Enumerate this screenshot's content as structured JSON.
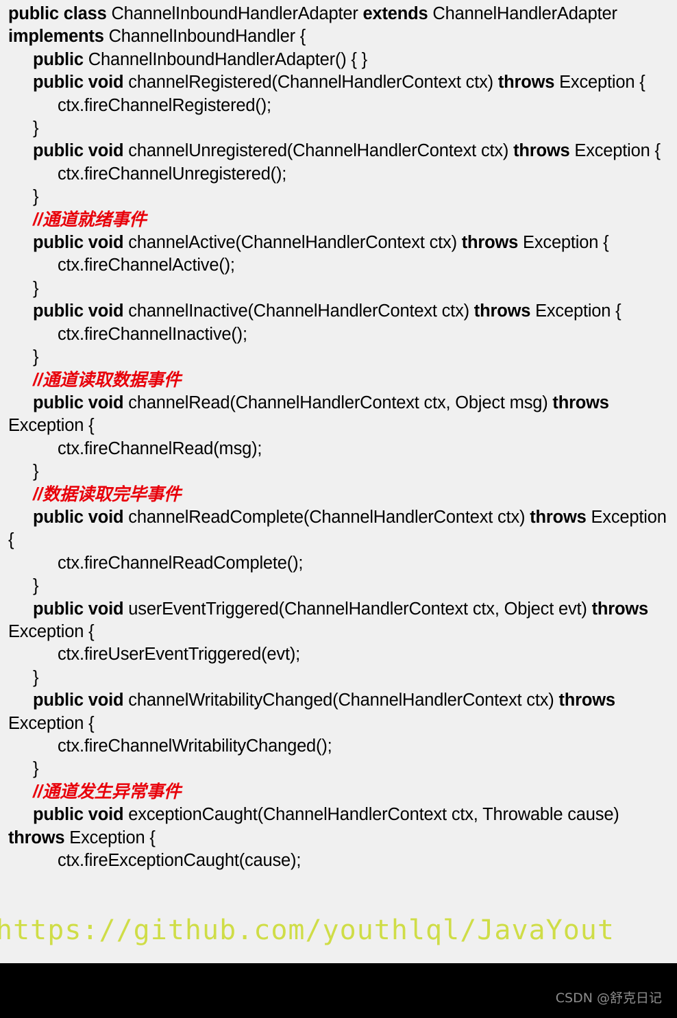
{
  "document": {
    "type": "java-code-snippet",
    "background_color": "#f0f0f0",
    "text_color": "#000000",
    "comment_color": "#e8000a",
    "bottom_bar_color": "#000000"
  },
  "code": {
    "lines": [
      {
        "id": "line-1",
        "indent": 0,
        "segments": [
          {
            "t": "public class ",
            "b": true
          },
          {
            "t": "ChannelInboundHandlerAdapter ",
            "b": false
          },
          {
            "t": "extends ",
            "b": true
          },
          {
            "t": "ChannelHandlerAdapter ",
            "b": false
          },
          {
            "t": "implements ",
            "b": true
          },
          {
            "t": "ChannelInboundHandler {",
            "b": false
          }
        ]
      },
      {
        "id": "line-2",
        "indent": 1,
        "segments": [
          {
            "t": "public ",
            "b": true
          },
          {
            "t": "ChannelInboundHandlerAdapter() { }",
            "b": false
          }
        ]
      },
      {
        "id": "line-3",
        "indent": 1,
        "segments": [
          {
            "t": "public void ",
            "b": true
          },
          {
            "t": "channelRegistered(ChannelHandlerContext ctx) ",
            "b": false
          },
          {
            "t": "throws ",
            "b": true
          },
          {
            "t": "Exception {",
            "b": false
          }
        ]
      },
      {
        "id": "line-4",
        "indent": 2,
        "segments": [
          {
            "t": "ctx.fireChannelRegistered();",
            "b": false
          }
        ]
      },
      {
        "id": "line-5",
        "indent": 1,
        "segments": [
          {
            "t": "}",
            "b": false
          }
        ]
      },
      {
        "id": "line-6",
        "indent": 1,
        "segments": [
          {
            "t": "public void ",
            "b": true
          },
          {
            "t": "channelUnregistered(ChannelHandlerContext ctx) ",
            "b": false
          },
          {
            "t": "throws ",
            "b": true
          },
          {
            "t": "Exception {",
            "b": false
          }
        ]
      },
      {
        "id": "line-7",
        "indent": 2,
        "segments": [
          {
            "t": "ctx.fireChannelUnregistered();",
            "b": false
          }
        ]
      },
      {
        "id": "line-8",
        "indent": 1,
        "segments": [
          {
            "t": "}",
            "b": false
          }
        ]
      },
      {
        "id": "line-9",
        "indent": 1,
        "comment": true,
        "segments": [
          {
            "t": "//通道就绪事件",
            "b": false
          }
        ]
      },
      {
        "id": "line-10",
        "indent": 1,
        "segments": [
          {
            "t": "public void ",
            "b": true
          },
          {
            "t": "channelActive(ChannelHandlerContext ctx) ",
            "b": false
          },
          {
            "t": "throws ",
            "b": true
          },
          {
            "t": "Exception {",
            "b": false
          }
        ]
      },
      {
        "id": "line-11",
        "indent": 2,
        "segments": [
          {
            "t": "ctx.fireChannelActive();",
            "b": false
          }
        ]
      },
      {
        "id": "line-12",
        "indent": 1,
        "segments": [
          {
            "t": "}",
            "b": false
          }
        ]
      },
      {
        "id": "line-13",
        "indent": 1,
        "segments": [
          {
            "t": "public void ",
            "b": true
          },
          {
            "t": "channelInactive(ChannelHandlerContext ctx) ",
            "b": false
          },
          {
            "t": "throws ",
            "b": true
          },
          {
            "t": "Exception {",
            "b": false
          }
        ]
      },
      {
        "id": "line-14",
        "indent": 2,
        "segments": [
          {
            "t": "ctx.fireChannelInactive();",
            "b": false
          }
        ]
      },
      {
        "id": "line-15",
        "indent": 1,
        "segments": [
          {
            "t": "}",
            "b": false
          }
        ]
      },
      {
        "id": "line-16",
        "indent": 1,
        "comment": true,
        "segments": [
          {
            "t": "//通道读取数据事件",
            "b": false
          }
        ]
      },
      {
        "id": "line-17",
        "indent": 1,
        "segments": [
          {
            "t": "public void ",
            "b": true
          },
          {
            "t": "channelRead(ChannelHandlerContext ctx, Object msg) ",
            "b": false
          },
          {
            "t": "throws ",
            "b": true
          },
          {
            "t": "Exception {",
            "b": false
          }
        ]
      },
      {
        "id": "line-18",
        "indent": 2,
        "segments": [
          {
            "t": "ctx.fireChannelRead(msg);",
            "b": false
          }
        ]
      },
      {
        "id": "line-19",
        "indent": 1,
        "segments": [
          {
            "t": "}",
            "b": false
          }
        ]
      },
      {
        "id": "line-20",
        "indent": 1,
        "comment": true,
        "segments": [
          {
            "t": "//数据读取完毕事件",
            "b": false
          }
        ]
      },
      {
        "id": "line-21",
        "indent": 1,
        "segments": [
          {
            "t": "public void ",
            "b": true
          },
          {
            "t": "channelReadComplete(ChannelHandlerContext ctx) ",
            "b": false
          },
          {
            "t": "throws ",
            "b": true
          },
          {
            "t": "Exception {",
            "b": false
          }
        ]
      },
      {
        "id": "line-22",
        "indent": 2,
        "segments": [
          {
            "t": "ctx.fireChannelReadComplete();",
            "b": false
          }
        ]
      },
      {
        "id": "line-23",
        "indent": 1,
        "segments": [
          {
            "t": "}",
            "b": false
          }
        ]
      },
      {
        "id": "line-24",
        "indent": 1,
        "segments": [
          {
            "t": "public void ",
            "b": true
          },
          {
            "t": "userEventTriggered(ChannelHandlerContext ctx, Object evt) ",
            "b": false
          },
          {
            "t": "throws ",
            "b": true
          },
          {
            "t": "Exception {",
            "b": false
          }
        ]
      },
      {
        "id": "line-25",
        "indent": 2,
        "segments": [
          {
            "t": "ctx.fireUserEventTriggered(evt);",
            "b": false
          }
        ]
      },
      {
        "id": "line-26",
        "indent": 1,
        "segments": [
          {
            "t": "}",
            "b": false
          }
        ]
      },
      {
        "id": "line-27",
        "indent": 1,
        "segments": [
          {
            "t": "public void ",
            "b": true
          },
          {
            "t": "channelWritabilityChanged(ChannelHandlerContext ctx) ",
            "b": false
          },
          {
            "t": "throws ",
            "b": true
          },
          {
            "t": "Exception {",
            "b": false
          }
        ]
      },
      {
        "id": "line-28",
        "indent": 2,
        "segments": [
          {
            "t": "ctx.fireChannelWritabilityChanged();",
            "b": false
          }
        ]
      },
      {
        "id": "line-29",
        "indent": 1,
        "segments": [
          {
            "t": "}",
            "b": false
          }
        ]
      },
      {
        "id": "line-30",
        "indent": 1,
        "comment": true,
        "segments": [
          {
            "t": "//通道发生异常事件",
            "b": false
          }
        ]
      },
      {
        "id": "line-31",
        "indent": 1,
        "segments": [
          {
            "t": "public void ",
            "b": true
          },
          {
            "t": "exceptionCaught(ChannelHandlerContext ctx, Throwable cause) ",
            "b": false
          },
          {
            "t": "throws ",
            "b": true
          },
          {
            "t": "Exception {",
            "b": false
          }
        ]
      },
      {
        "id": "line-32",
        "indent": 2,
        "segments": [
          {
            "t": "ctx.fireExceptionCaught(cause);",
            "b": false
          }
        ]
      }
    ]
  },
  "watermarks": {
    "url": "https://github.com/youthlql/JavaYout",
    "url_color": "#cddc39",
    "csdn": "CSDN @舒克日记",
    "csdn_color": "#8c8c8c"
  }
}
